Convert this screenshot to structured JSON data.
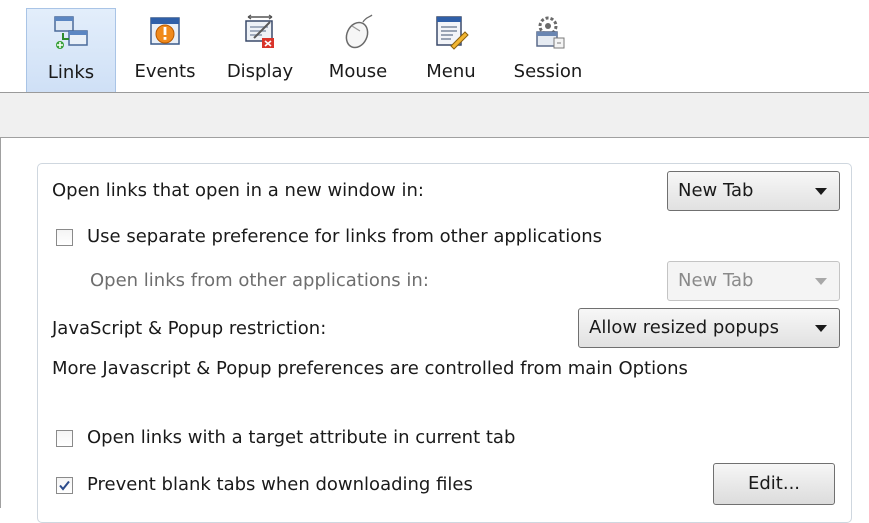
{
  "toolbar": {
    "items": [
      {
        "label": "Links",
        "icon": "links-icon",
        "selected": true
      },
      {
        "label": "Events",
        "icon": "events-icon",
        "selected": false
      },
      {
        "label": "Display",
        "icon": "display-icon",
        "selected": false
      },
      {
        "label": "Mouse",
        "icon": "mouse-icon",
        "selected": false
      },
      {
        "label": "Menu",
        "icon": "menu-icon",
        "selected": false
      },
      {
        "label": "Session",
        "icon": "session-icon",
        "selected": false
      }
    ]
  },
  "links": {
    "new_window_label": "Open links that open in a new window in:",
    "new_window_value": "New Tab",
    "separate_pref_label": "Use separate preference for links from other applications",
    "separate_pref_checked": false,
    "other_apps_label": "Open links from other applications in:",
    "other_apps_value": "New Tab",
    "popup_label": "JavaScript & Popup restriction:",
    "popup_value": "Allow resized popups",
    "popup_note": "More Javascript & Popup preferences are controlled from main Options",
    "target_attr_label": "Open links with a target attribute in current tab",
    "target_attr_checked": false,
    "prevent_blank_label": "Prevent blank tabs when downloading files",
    "prevent_blank_checked": true,
    "edit_button": "Edit..."
  },
  "colors": {
    "selected_tab_bg": "#d6e6f8",
    "check_mark": "#2b4a8a"
  }
}
